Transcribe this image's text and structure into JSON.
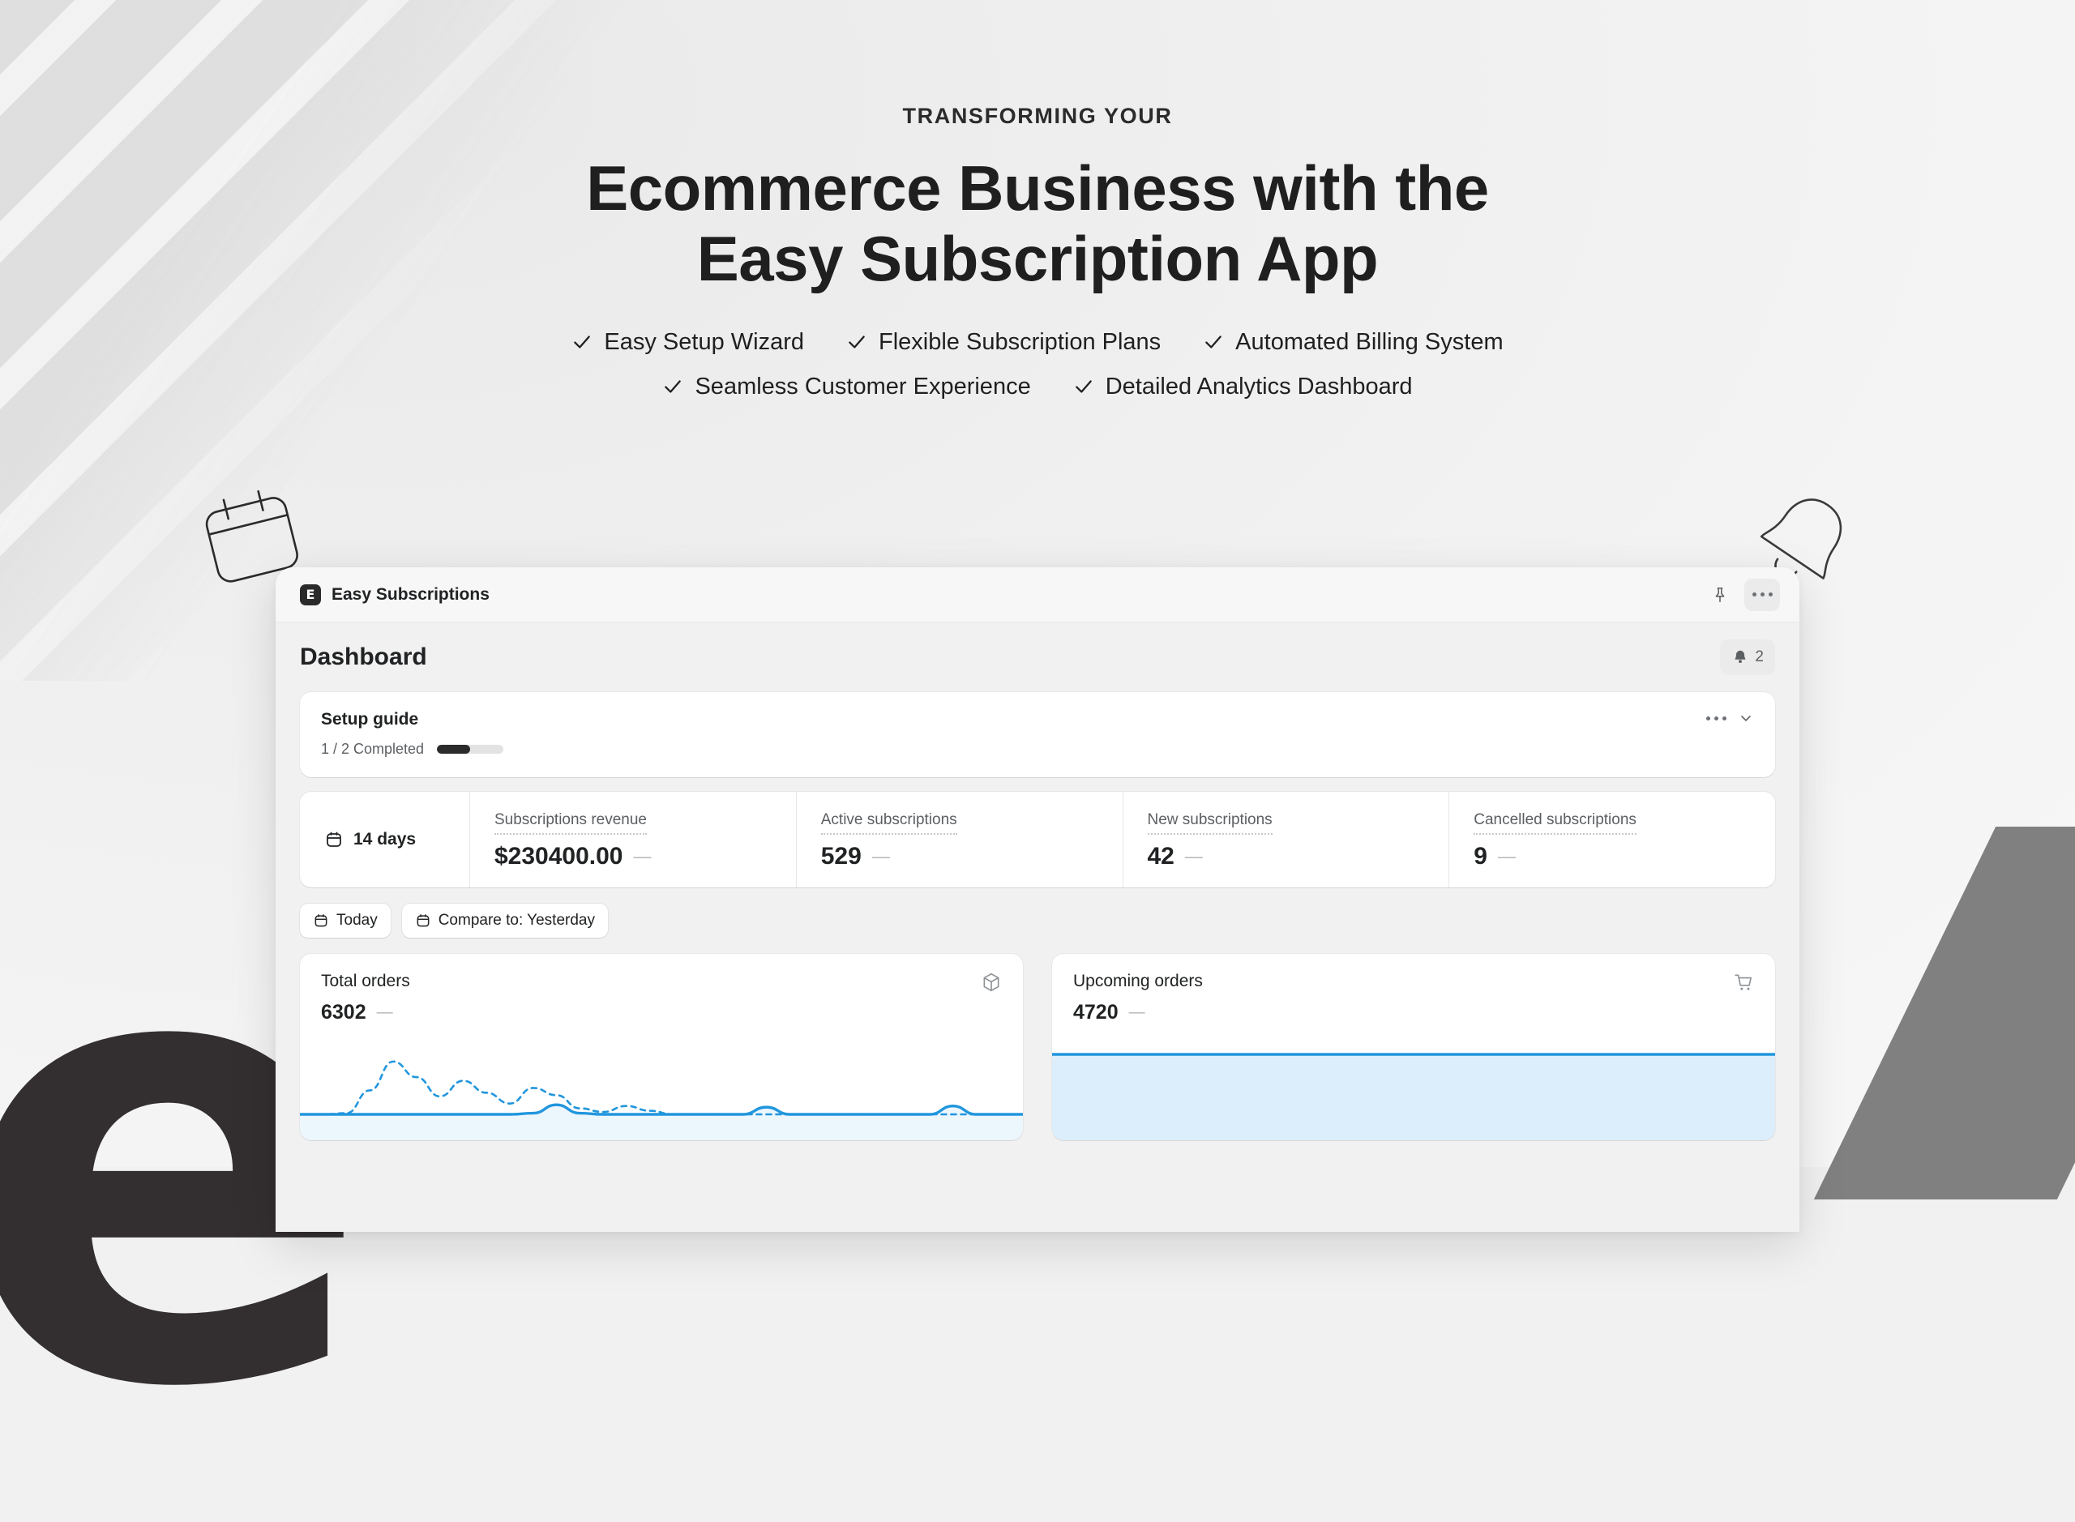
{
  "hero": {
    "eyebrow": "TRANSFORMING YOUR",
    "headline_line1": "Ecommerce Business with the",
    "headline_line2": "Easy Subscription App",
    "features_row1": [
      "Easy Setup Wizard",
      "Flexible Subscription Plans",
      "Automated Billing System"
    ],
    "features_row2": [
      "Seamless Customer Experience",
      "Detailed Analytics Dashboard"
    ]
  },
  "window": {
    "app_name": "Easy Subscriptions",
    "logo_glyph": "E",
    "pin_icon": "pin-icon",
    "more_icon": "more-horizontal-icon"
  },
  "page": {
    "title": "Dashboard",
    "notifications_count": "2",
    "bell_icon": "bell-icon"
  },
  "setup_guide": {
    "title": "Setup guide",
    "progress_label": "1 / 2 Completed",
    "completed": 1,
    "total": 2,
    "progress_percent": 50,
    "more_icon": "more-horizontal-icon",
    "collapse_icon": "chevron-down-icon"
  },
  "metrics": {
    "range_label": "14 days",
    "range_icon": "calendar-icon",
    "items": [
      {
        "label": "Subscriptions revenue",
        "value": "$230400.00",
        "delta": "—"
      },
      {
        "label": "Active subscriptions",
        "value": "529",
        "delta": "—"
      },
      {
        "label": "New subscriptions",
        "value": "42",
        "delta": "—"
      },
      {
        "label": "Cancelled subscriptions",
        "value": "9",
        "delta": "—"
      }
    ]
  },
  "filters": [
    {
      "label": "Today",
      "icon": "calendar-icon"
    },
    {
      "label": "Compare to: Yesterday",
      "icon": "calendar-icon"
    }
  ],
  "colors": {
    "accent_line": "#2196dd",
    "accent_fill": "#dceefb",
    "text_primary": "#202223",
    "text_secondary": "#5c5f62",
    "progress_fill": "#2b2b2b",
    "parallelogram": "#808080",
    "letter_e": "#332f31"
  },
  "chart_data": [
    {
      "type": "line",
      "title": "Total orders",
      "value": "6302",
      "delta": "—",
      "icon": "package-icon",
      "xlabel": "",
      "ylabel": "",
      "ylim": [
        0,
        100
      ],
      "grid": false,
      "legend": "none",
      "x": [
        0,
        1,
        2,
        3,
        4,
        5,
        6,
        7,
        8,
        9,
        10,
        11,
        12,
        13,
        14,
        15,
        16,
        17,
        18,
        19,
        20,
        21,
        22,
        23,
        24,
        25,
        26,
        27,
        28,
        29,
        30,
        31
      ],
      "series": [
        {
          "name": "Today",
          "style": "solid",
          "values": [
            0,
            0,
            0,
            0,
            0,
            0,
            0,
            0,
            0,
            0,
            2,
            16,
            2,
            0,
            0,
            0,
            0,
            0,
            0,
            0,
            12,
            0,
            0,
            0,
            0,
            0,
            0,
            0,
            14,
            0,
            0,
            0
          ]
        },
        {
          "name": "Yesterday",
          "style": "dashed",
          "values": [
            0,
            0,
            2,
            40,
            88,
            62,
            30,
            56,
            36,
            18,
            44,
            32,
            10,
            4,
            14,
            6,
            0,
            0,
            0,
            0,
            0,
            0,
            0,
            0,
            0,
            0,
            0,
            0,
            0,
            0,
            0,
            0
          ]
        }
      ]
    },
    {
      "type": "area",
      "title": "Upcoming orders",
      "value": "4720",
      "delta": "—",
      "icon": "cart-icon",
      "xlabel": "",
      "ylabel": "",
      "ylim": [
        0,
        100
      ],
      "grid": false,
      "legend": "none",
      "x": [
        0,
        1,
        2,
        3,
        4,
        5,
        6,
        7,
        8,
        9,
        10
      ],
      "series": [
        {
          "name": "Upcoming",
          "style": "solid",
          "values": [
            100,
            100,
            100,
            100,
            100,
            100,
            100,
            100,
            100,
            100,
            100
          ]
        }
      ]
    }
  ]
}
